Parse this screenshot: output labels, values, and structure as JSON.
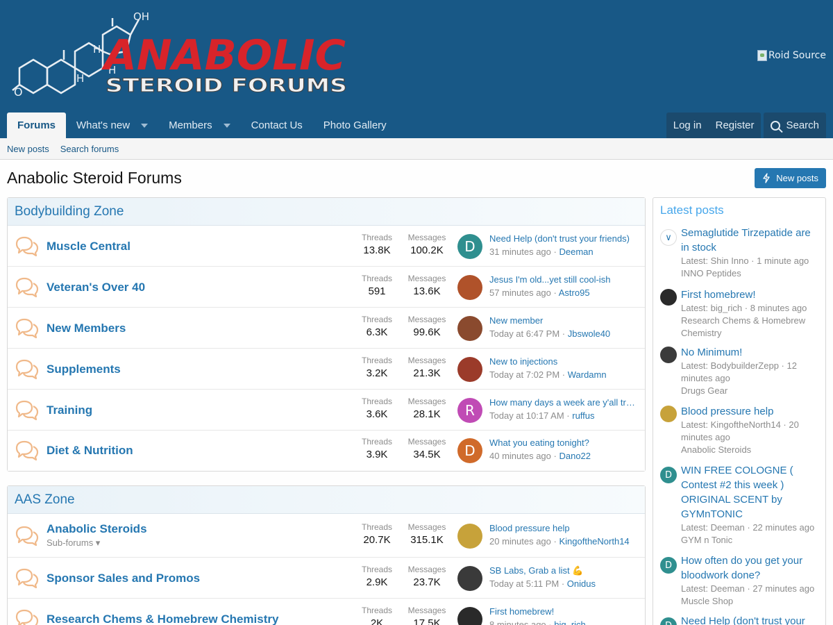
{
  "header": {
    "logo_text": "ANABOLIC",
    "logo_subtext": "STEROID FORUMS",
    "logo_chem_labels": [
      "OH",
      "H",
      "H",
      "H",
      "O"
    ],
    "sponsor_alt": "Roid Source"
  },
  "nav": {
    "tabs": [
      {
        "label": "Forums",
        "active": true
      },
      {
        "label": "What's new",
        "dropdown": true
      },
      {
        "label": "Members",
        "dropdown": true
      },
      {
        "label": "Contact Us"
      },
      {
        "label": "Photo Gallery"
      }
    ],
    "login": "Log in",
    "register": "Register",
    "search": "Search"
  },
  "subnav": {
    "new_posts": "New posts",
    "search_forums": "Search forums"
  },
  "page": {
    "title": "Anabolic Steroid Forums",
    "new_posts_button": "New posts"
  },
  "categories": [
    {
      "title": "Bodybuilding Zone",
      "forums": [
        {
          "title": "Muscle Central",
          "threads_label": "Threads",
          "threads": "13.8K",
          "messages_label": "Messages",
          "messages": "100.2K",
          "last_title": "Need Help (don't trust your friends)",
          "last_time": "31 minutes ago",
          "last_user": "Deeman",
          "avatar_letter": "D",
          "avatar_color": "#2f8f8f"
        },
        {
          "title": "Veteran's Over 40",
          "threads_label": "Threads",
          "threads": "591",
          "messages_label": "Messages",
          "messages": "13.6K",
          "last_title": "Jesus I'm old...yet still cool-ish",
          "last_time": "57 minutes ago",
          "last_user": "Astro95",
          "avatar_letter": "",
          "avatar_color": "#b0522a"
        },
        {
          "title": "New Members",
          "threads_label": "Threads",
          "threads": "6.3K",
          "messages_label": "Messages",
          "messages": "99.6K",
          "last_title": "New member",
          "last_time": "Today at 6:47 PM",
          "last_user": "Jbswole40",
          "avatar_letter": "",
          "avatar_color": "#8a4a2e"
        },
        {
          "title": "Supplements",
          "threads_label": "Threads",
          "threads": "3.2K",
          "messages_label": "Messages",
          "messages": "21.3K",
          "last_title": "New to injections",
          "last_time": "Today at 7:02 PM",
          "last_user": "Wardamn",
          "avatar_letter": "",
          "avatar_color": "#9b3b2a"
        },
        {
          "title": "Training",
          "threads_label": "Threads",
          "threads": "3.6K",
          "messages_label": "Messages",
          "messages": "28.1K",
          "last_title": "How many days a week are y'all training?",
          "last_time": "Today at 10:17 AM",
          "last_user": "ruffus",
          "avatar_letter": "R",
          "avatar_color": "#c04bb5"
        },
        {
          "title": "Diet & Nutrition",
          "threads_label": "Threads",
          "threads": "3.9K",
          "messages_label": "Messages",
          "messages": "34.5K",
          "last_title": "What you eating tonight?",
          "last_time": "40 minutes ago",
          "last_user": "Dano22",
          "avatar_letter": "D",
          "avatar_color": "#d06a2a"
        }
      ]
    },
    {
      "title": "AAS Zone",
      "forums": [
        {
          "title": "Anabolic Steroids",
          "sub": "Sub-forums",
          "threads_label": "Threads",
          "threads": "20.7K",
          "messages_label": "Messages",
          "messages": "315.1K",
          "last_title": "Blood pressure help",
          "last_time": "20 minutes ago",
          "last_user": "KingoftheNorth14",
          "avatar_letter": "",
          "avatar_color": "#c7a23a"
        },
        {
          "title": "Sponsor Sales and Promos",
          "threads_label": "Threads",
          "threads": "2.9K",
          "messages_label": "Messages",
          "messages": "23.7K",
          "last_title": "SB Labs, Grab a list 💪",
          "last_time": "Today at 5:11 PM",
          "last_user": "Onidus",
          "avatar_letter": "",
          "avatar_color": "#3a3a3a"
        },
        {
          "title": "Research Chems & Homebrew Chemistry",
          "threads_label": "Threads",
          "threads": "2K",
          "messages_label": "Messages",
          "messages": "17.5K",
          "last_title": "First homebrew!",
          "last_time": "8 minutes ago",
          "last_user": "big_rich",
          "avatar_letter": "",
          "avatar_color": "#2a2a2a"
        }
      ]
    }
  ],
  "sidebar": {
    "title": "Latest posts",
    "items": [
      {
        "title": "Semaglutide Tirzepatide are in stock",
        "meta": "Latest: Shin Inno · 1 minute ago",
        "forum": "INNO Peptides",
        "avatar_letter": "",
        "avatar_color": "#ffffff"
      },
      {
        "title": "First homebrew!",
        "meta": "Latest: big_rich · 8 minutes ago",
        "forum": "Research Chems & Homebrew Chemistry",
        "avatar_letter": "",
        "avatar_color": "#2a2a2a"
      },
      {
        "title": "No Minimum!",
        "meta": "Latest: BodybuilderZepp · 12 minutes ago",
        "forum": "Drugs Gear",
        "avatar_letter": "",
        "avatar_color": "#3b3b3b"
      },
      {
        "title": "Blood pressure help",
        "meta": "Latest: KingoftheNorth14 · 20 minutes ago",
        "forum": "Anabolic Steroids",
        "avatar_letter": "",
        "avatar_color": "#c7a23a"
      },
      {
        "title": "WIN FREE COLOGNE ( Contest #2 this week ) ORIGINAL SCENT by GYMnTONIC",
        "meta": "Latest: Deeman · 22 minutes ago",
        "forum": "GYM n Tonic",
        "avatar_letter": "D",
        "avatar_color": "#2f8f8f"
      },
      {
        "title": "How often do you get your bloodwork done?",
        "meta": "Latest: Deeman · 27 minutes ago",
        "forum": "Muscle Shop",
        "avatar_letter": "D",
        "avatar_color": "#2f8f8f"
      },
      {
        "title": "Need Help (don't trust your friends)",
        "meta": "",
        "forum": "",
        "avatar_letter": "D",
        "avatar_color": "#2f8f8f"
      }
    ]
  }
}
